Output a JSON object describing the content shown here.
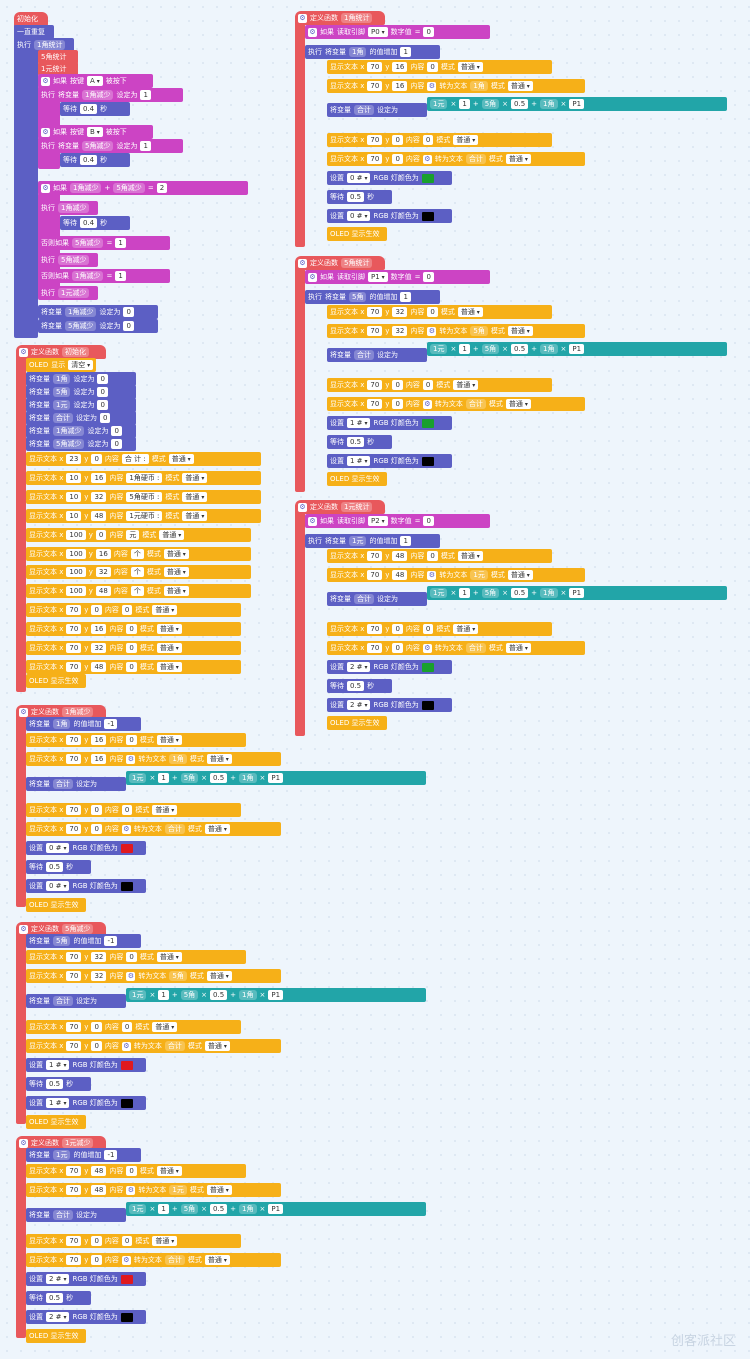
{
  "w": {
    "init_hat": "初始化",
    "forever": "一直重复",
    "exec": "执行",
    "else_if": "否则如果",
    "if": "如果",
    "stat1": "1角统计",
    "stat5": "5角统计",
    "stat10": "1元统计",
    "button_kw": "按键",
    "pressed": "被按下",
    "btnA": "A",
    "btnB": "B",
    "set_var": "将变量",
    "set_to": "设定为",
    "wait": "等待",
    "sec": "秒",
    "v1j": "1角减少",
    "v5j": "5角减少",
    "v1y": "1元减少",
    "plus": "+",
    "eq": "=",
    "one": "1",
    "two": "2",
    "zero": "0",
    "p4": "0.4",
    "p5": "0.5",
    "p1": "P1",
    "def_fn": "定义函数",
    "init_fn": "初始化",
    "oled": "OLED",
    "oled_show": "显示",
    "clear": "清空",
    "j1": "1角",
    "j5": "5角",
    "y1": "1元",
    "total": "合计",
    "disp_txt": "显示文本 x",
    "y": "y",
    "content": "内容",
    "mode": "模式",
    "normal": "普通",
    "total_lbl": "合 计 :",
    "coin1": "1角硬币 :",
    "coin5": "5角硬币 :",
    "coin10": "1元硬币 :",
    "yuan": "元",
    "ge": "个",
    "n23": "23",
    "n10": "10",
    "n100": "100",
    "n70": "70",
    "n16": "16",
    "n32": "32",
    "n48": "48",
    "oled_apply": "OLED 显示生效",
    "read_pin": "读取引脚",
    "digital": "数字值",
    "p0": "P0",
    "p2": "P2",
    "inc_by": "的值增加",
    "to_text": "转为文本",
    "times": "×",
    "m1": "-1",
    "rgb_set": "设置",
    "rgb_lamp": "RGB 灯颜色为",
    "led0": "0 #",
    "led1": "1 #",
    "led2": "2 #",
    "green": "#19a02c",
    "black": "#000000",
    "red": "#e0191e",
    "watermark": "创客派社区"
  }
}
